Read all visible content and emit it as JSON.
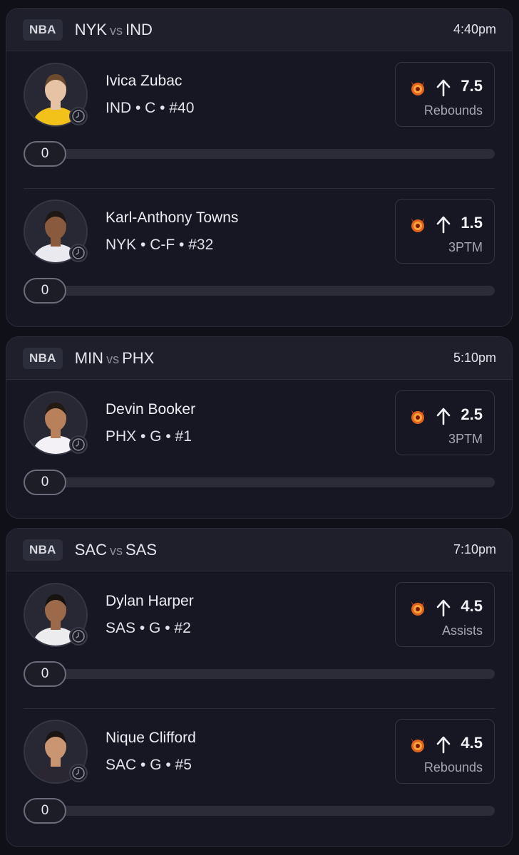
{
  "colors": {
    "background": "#0f1018",
    "card": "#161722",
    "header": "#1e1f2b",
    "accent_devil": "#e05a1a"
  },
  "games": [
    {
      "league": "NBA",
      "away": "NYK",
      "vs": "vs",
      "home": "IND",
      "time": "4:40pm",
      "players": [
        {
          "name": "Ivica Zubac",
          "meta": "IND • C • #40",
          "icon": "devil-icon",
          "direction": "up-arrow-icon",
          "line": "7.5",
          "stat": "Rebounds",
          "progress": "0",
          "jersey_color": "#f2c21b",
          "skin": "#e7c3a6",
          "hair": "#6b4a2e"
        },
        {
          "name": "Karl-Anthony Towns",
          "meta": "NYK • C-F • #32",
          "icon": "devil-icon",
          "direction": "up-arrow-icon",
          "line": "1.5",
          "stat": "3PTM",
          "progress": "0",
          "jersey_color": "#e9e9ef",
          "skin": "#8a5a3f",
          "hair": "#1e1714"
        }
      ]
    },
    {
      "league": "NBA",
      "away": "MIN",
      "vs": "vs",
      "home": "PHX",
      "time": "5:10pm",
      "players": [
        {
          "name": "Devin Booker",
          "meta": "PHX • G • #1",
          "icon": "devil-icon",
          "direction": "up-arrow-icon",
          "line": "2.5",
          "stat": "3PTM",
          "progress": "0",
          "jersey_color": "#f3f1f6",
          "skin": "#b9805c",
          "hair": "#241a14"
        }
      ]
    },
    {
      "league": "NBA",
      "away": "SAC",
      "vs": "vs",
      "home": "SAS",
      "time": "7:10pm",
      "players": [
        {
          "name": "Dylan Harper",
          "meta": "SAS • G • #2",
          "icon": "devil-icon",
          "direction": "up-arrow-icon",
          "line": "4.5",
          "stat": "Assists",
          "progress": "0",
          "jersey_color": "#ececef",
          "skin": "#9c6a4a",
          "hair": "#161210"
        },
        {
          "name": "Nique Clifford",
          "meta": "SAC • G • #5",
          "icon": "devil-icon",
          "direction": "up-arrow-icon",
          "line": "4.5",
          "stat": "Rebounds",
          "progress": "0",
          "jersey_color": "#2a2733",
          "skin": "#c99573",
          "hair": "#1a1412"
        }
      ]
    }
  ]
}
